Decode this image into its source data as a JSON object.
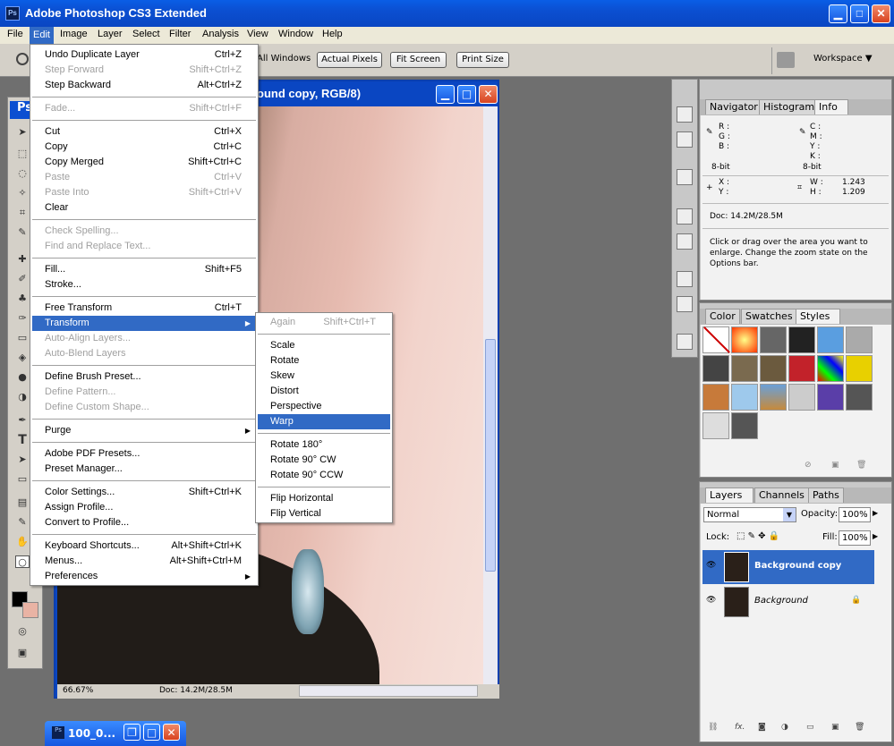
{
  "app": {
    "title": "Adobe Photoshop CS3 Extended",
    "logo": "Ps"
  },
  "menubar": [
    "File",
    "Edit",
    "Image",
    "Layer",
    "Select",
    "Filter",
    "Analysis",
    "View",
    "Window",
    "Help"
  ],
  "options": {
    "all_windows": "All Windows",
    "actual_pixels": "Actual Pixels",
    "fit_screen": "Fit Screen",
    "print_size": "Print Size",
    "workspace": "Workspace ▼"
  },
  "document": {
    "title": "ound copy, RGB/8)",
    "zoom": "66.67%",
    "doc_size": "Doc: 14.2M/28.5M"
  },
  "edit_menu": [
    {
      "label": "Undo Duplicate Layer",
      "shortcut": "Ctrl+Z",
      "disabled": false
    },
    {
      "label": "Step Forward",
      "shortcut": "Shift+Ctrl+Z",
      "disabled": true
    },
    {
      "label": "Step Backward",
      "shortcut": "Alt+Ctrl+Z",
      "disabled": false
    },
    {
      "sep": true
    },
    {
      "label": "Fade...",
      "shortcut": "Shift+Ctrl+F",
      "disabled": true
    },
    {
      "sep": true
    },
    {
      "label": "Cut",
      "shortcut": "Ctrl+X",
      "disabled": false
    },
    {
      "label": "Copy",
      "shortcut": "Ctrl+C",
      "disabled": false
    },
    {
      "label": "Copy Merged",
      "shortcut": "Shift+Ctrl+C",
      "disabled": false
    },
    {
      "label": "Paste",
      "shortcut": "Ctrl+V",
      "disabled": true
    },
    {
      "label": "Paste Into",
      "shortcut": "Shift+Ctrl+V",
      "disabled": true
    },
    {
      "label": "Clear",
      "shortcut": "",
      "disabled": false
    },
    {
      "sep": true
    },
    {
      "label": "Check Spelling...",
      "shortcut": "",
      "disabled": true
    },
    {
      "label": "Find and Replace Text...",
      "shortcut": "",
      "disabled": true
    },
    {
      "sep": true
    },
    {
      "label": "Fill...",
      "shortcut": "Shift+F5",
      "disabled": false
    },
    {
      "label": "Stroke...",
      "shortcut": "",
      "disabled": false
    },
    {
      "sep": true
    },
    {
      "label": "Free Transform",
      "shortcut": "Ctrl+T",
      "disabled": false
    },
    {
      "label": "Transform",
      "shortcut": "",
      "disabled": false,
      "selected": true,
      "submenu": true
    },
    {
      "label": "Auto-Align Layers...",
      "shortcut": "",
      "disabled": true
    },
    {
      "label": "Auto-Blend Layers",
      "shortcut": "",
      "disabled": true
    },
    {
      "sep": true
    },
    {
      "label": "Define Brush Preset...",
      "shortcut": "",
      "disabled": false
    },
    {
      "label": "Define Pattern...",
      "shortcut": "",
      "disabled": true
    },
    {
      "label": "Define Custom Shape...",
      "shortcut": "",
      "disabled": true
    },
    {
      "sep": true
    },
    {
      "label": "Purge",
      "shortcut": "",
      "disabled": false,
      "submenu": true
    },
    {
      "sep": true
    },
    {
      "label": "Adobe PDF Presets...",
      "shortcut": "",
      "disabled": false
    },
    {
      "label": "Preset Manager...",
      "shortcut": "",
      "disabled": false
    },
    {
      "sep": true
    },
    {
      "label": "Color Settings...",
      "shortcut": "Shift+Ctrl+K",
      "disabled": false
    },
    {
      "label": "Assign Profile...",
      "shortcut": "",
      "disabled": false
    },
    {
      "label": "Convert to Profile...",
      "shortcut": "",
      "disabled": false
    },
    {
      "sep": true
    },
    {
      "label": "Keyboard Shortcuts...",
      "shortcut": "Alt+Shift+Ctrl+K",
      "disabled": false
    },
    {
      "label": "Menus...",
      "shortcut": "Alt+Shift+Ctrl+M",
      "disabled": false
    },
    {
      "label": "Preferences",
      "shortcut": "",
      "disabled": false,
      "submenu": true
    }
  ],
  "transform_menu": [
    {
      "label": "Again",
      "shortcut": "Shift+Ctrl+T",
      "disabled": true
    },
    {
      "sep": true
    },
    {
      "label": "Scale",
      "shortcut": "",
      "disabled": false
    },
    {
      "label": "Rotate",
      "shortcut": "",
      "disabled": false
    },
    {
      "label": "Skew",
      "shortcut": "",
      "disabled": false
    },
    {
      "label": "Distort",
      "shortcut": "",
      "disabled": false
    },
    {
      "label": "Perspective",
      "shortcut": "",
      "disabled": false
    },
    {
      "label": "Warp",
      "shortcut": "",
      "disabled": false,
      "selected": true
    },
    {
      "sep": true
    },
    {
      "label": "Rotate 180°",
      "shortcut": "",
      "disabled": false
    },
    {
      "label": "Rotate 90° CW",
      "shortcut": "",
      "disabled": false
    },
    {
      "label": "Rotate 90° CCW",
      "shortcut": "",
      "disabled": false
    },
    {
      "sep": true
    },
    {
      "label": "Flip Horizontal",
      "shortcut": "",
      "disabled": false
    },
    {
      "label": "Flip Vertical",
      "shortcut": "",
      "disabled": false
    }
  ],
  "info_panel": {
    "tabs": [
      "Navigator",
      "Histogram",
      "Info"
    ],
    "r": "R :",
    "g": "G :",
    "b": "B :",
    "c": "C :",
    "m": "M :",
    "y": "Y :",
    "k": "K :",
    "bit1": "8-bit",
    "bit2": "8-bit",
    "x": "X :",
    "yy": "Y :",
    "w": "W :",
    "h": "H :",
    "wval": "1.243",
    "hval": "1.209",
    "doc": "Doc: 14.2M/28.5M",
    "hint": "Click or drag over the area you want to enlarge. Change the zoom state on the Options bar."
  },
  "styles_panel": {
    "tabs": [
      "Color",
      "Swatches",
      "Styles"
    ]
  },
  "layers_panel": {
    "tabs": [
      "Layers",
      "Channels",
      "Paths"
    ],
    "blend": "Normal",
    "opacity_label": "Opacity:",
    "opacity": "100%",
    "lock_label": "Lock:",
    "fill_label": "Fill:",
    "fill": "100%",
    "layers": [
      "Background copy",
      "Background"
    ]
  },
  "minimized": {
    "label": "100_0..."
  }
}
